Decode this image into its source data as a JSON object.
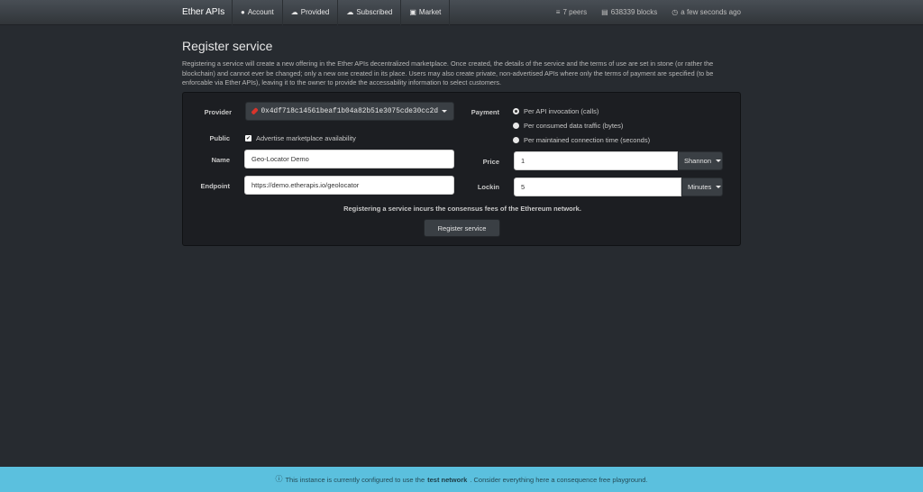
{
  "navbar": {
    "brand": "Ether APIs",
    "items": [
      {
        "label": "Account",
        "icon": "user-icon",
        "glyph": "●"
      },
      {
        "label": "Provided",
        "icon": "cloud-upload-icon",
        "glyph": "☁"
      },
      {
        "label": "Subscribed",
        "icon": "cloud-download-icon",
        "glyph": "☁"
      },
      {
        "label": "Market",
        "icon": "basket-icon",
        "glyph": "▣"
      }
    ],
    "stats": [
      {
        "label": "7 peers",
        "icon": "rss-icon",
        "glyph": "≡"
      },
      {
        "label": "638339 blocks",
        "icon": "database-icon",
        "glyph": "▤"
      },
      {
        "label": "a few seconds ago",
        "icon": "clock-icon",
        "glyph": "◷"
      }
    ]
  },
  "page": {
    "title": "Register service",
    "intro": "Registering a service will create a new offering in the Ether APIs decentralized marketplace. Once created, the details of the service and the terms of use are set in stone (or rather the blockchain) and cannot ever be changed; only a new one created in its place. Users may also create private, non-advertised APIs where only the terms of payment are specified (to be enforcable via Ether APIs), leaving it to the owner to provide the accessability information to select customers."
  },
  "form": {
    "provider_label": "Provider",
    "provider_value": "0x4df718c14561beaf1b04a82b51e3075cde30cc2d",
    "public_label": "Public",
    "public_checkbox_label": "Advertise marketplace availability",
    "public_checked": true,
    "name_label": "Name",
    "name_value": "Geo-Locator Demo",
    "endpoint_label": "Endpoint",
    "endpoint_value": "https://demo.etherapis.io/geolocator",
    "payment_label": "Payment",
    "payment_options": [
      {
        "label": "Per API invocation (calls)",
        "selected": true
      },
      {
        "label": "Per consumed data traffic (bytes)",
        "selected": false
      },
      {
        "label": "Per maintained connection time (seconds)",
        "selected": false
      }
    ],
    "price_label": "Price",
    "price_value": "1",
    "price_unit": "Shannon",
    "lockin_label": "Lockin",
    "lockin_value": "5",
    "lockin_unit": "Minutes",
    "fee_note": "Registering a service incurs the consensus fees of the Ethereum network.",
    "submit_label": "Register service"
  },
  "banner": {
    "icon": "info-icon",
    "glyph": "ⓘ",
    "text_before": "This instance is currently configured to use the",
    "emphasis": "test network",
    "text_after": ". Consider everything here a consequence free playground.",
    "color": "#5bc0de"
  }
}
